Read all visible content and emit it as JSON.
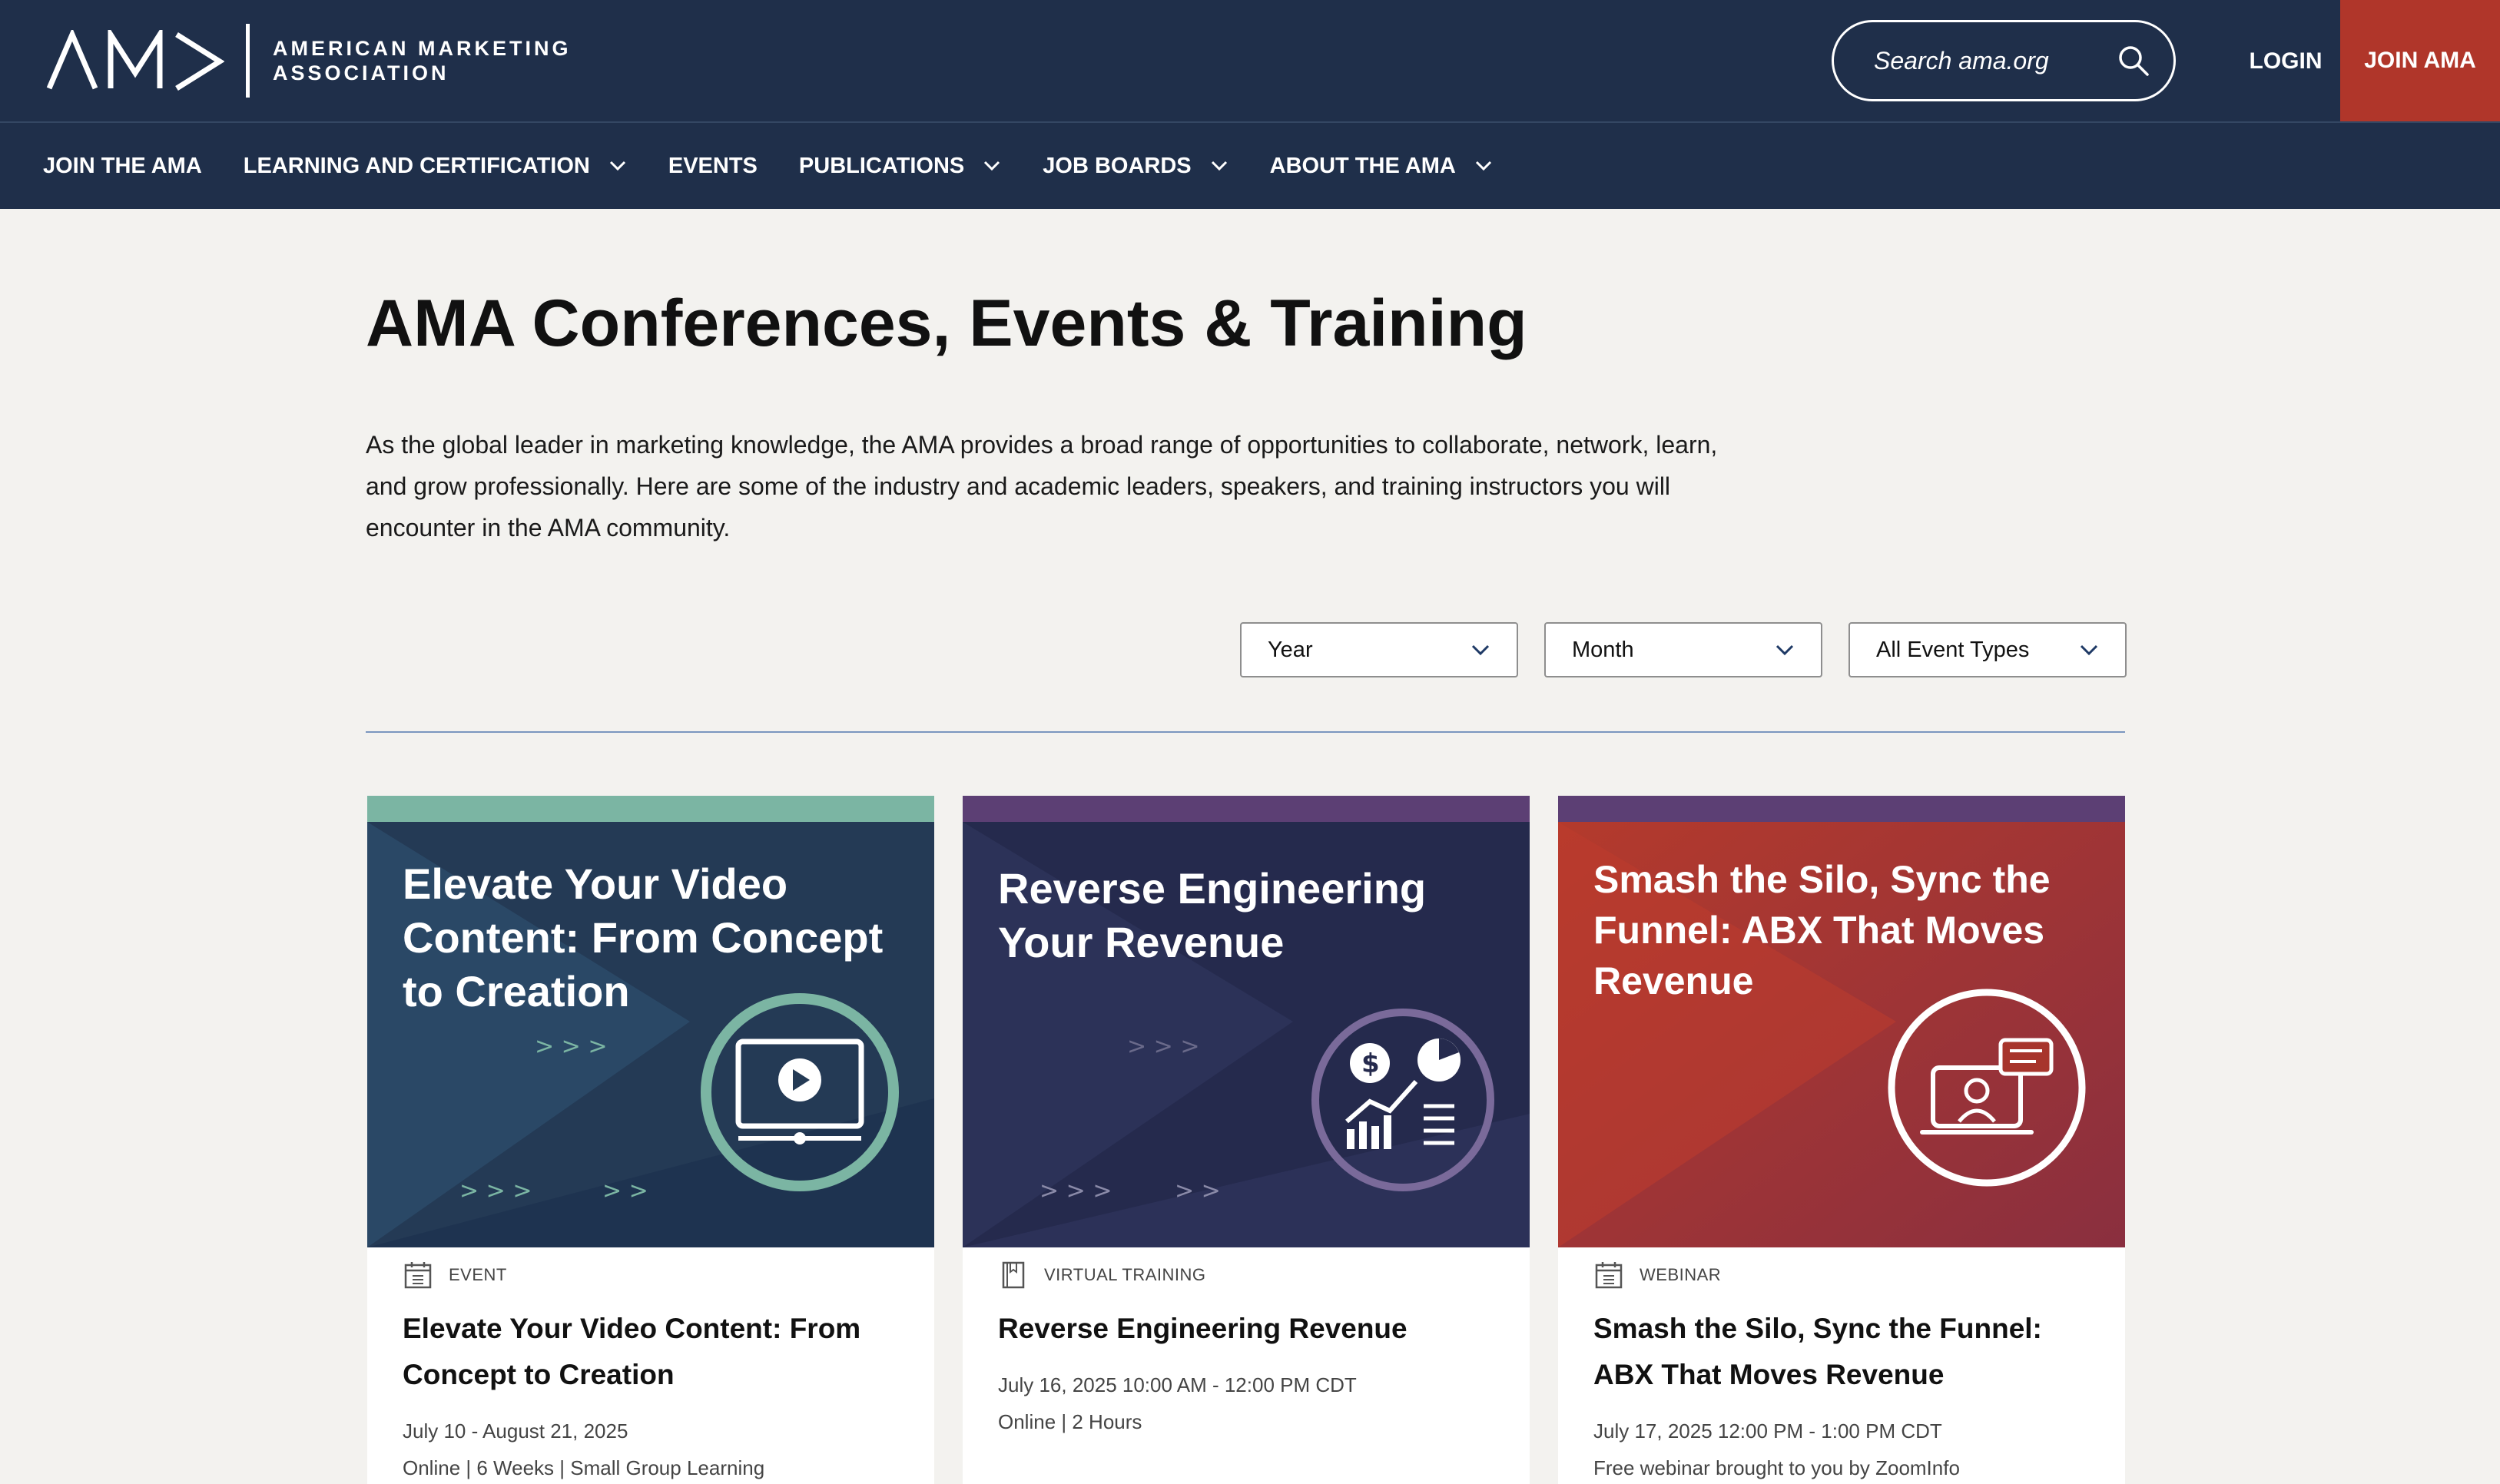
{
  "header": {
    "logo_text_line1": "AMERICAN MARKETING",
    "logo_text_line2": "ASSOCIATION",
    "search_placeholder": "Search ama.org",
    "login": "LOGIN",
    "join": "JOIN AMA"
  },
  "nav": {
    "items": [
      {
        "label": "JOIN THE AMA",
        "has_dropdown": false
      },
      {
        "label": "LEARNING AND CERTIFICATION",
        "has_dropdown": true
      },
      {
        "label": "EVENTS",
        "has_dropdown": false
      },
      {
        "label": "PUBLICATIONS",
        "has_dropdown": true
      },
      {
        "label": "JOB BOARDS",
        "has_dropdown": true
      },
      {
        "label": "ABOUT THE AMA",
        "has_dropdown": true
      }
    ]
  },
  "page": {
    "title": "AMA Conferences, Events & Training",
    "intro": "As the global leader in marketing knowledge, the AMA provides a broad range of opportunities to collaborate, network, learn, and grow professionally. Here are some of the industry and academic leaders, speakers, and training instructors you will encounter in the AMA community."
  },
  "filters": {
    "year": "Year",
    "month": "Month",
    "event_type": "All Event Types"
  },
  "cards": [
    {
      "art_title": "Elevate Your Video Content: From Concept to Creation",
      "type": "EVENT",
      "type_icon": "calendar-icon",
      "title": "Elevate Your Video Content: From Concept to Creation",
      "date": "July 10 - August 21, 2025",
      "details": "Online | 6 Weeks | Small Group Learning",
      "strip_color": "#7bb5a3",
      "art_color": "#243a55"
    },
    {
      "art_title": "Reverse Engineering Your Revenue",
      "type": "VIRTUAL TRAINING",
      "type_icon": "book-icon",
      "title": "Reverse Engineering Revenue",
      "date": "July 16, 2025 10:00 AM - 12:00 PM CDT",
      "details": "Online | 2 Hours",
      "strip_color": "#5c3f74",
      "art_color": "#252a4d"
    },
    {
      "art_title": "Smash the Silo, Sync the Funnel: ABX That Moves Revenue",
      "type": "WEBINAR",
      "type_icon": "calendar-icon",
      "title": "Smash the Silo, Sync the Funnel: ABX That Moves Revenue",
      "date": "July 17, 2025 12:00 PM - 1:00 PM CDT",
      "details": "Free webinar brought to you by ZoomInfo",
      "strip_color": "#5c3f74",
      "art_color": "#a7352c"
    }
  ]
}
